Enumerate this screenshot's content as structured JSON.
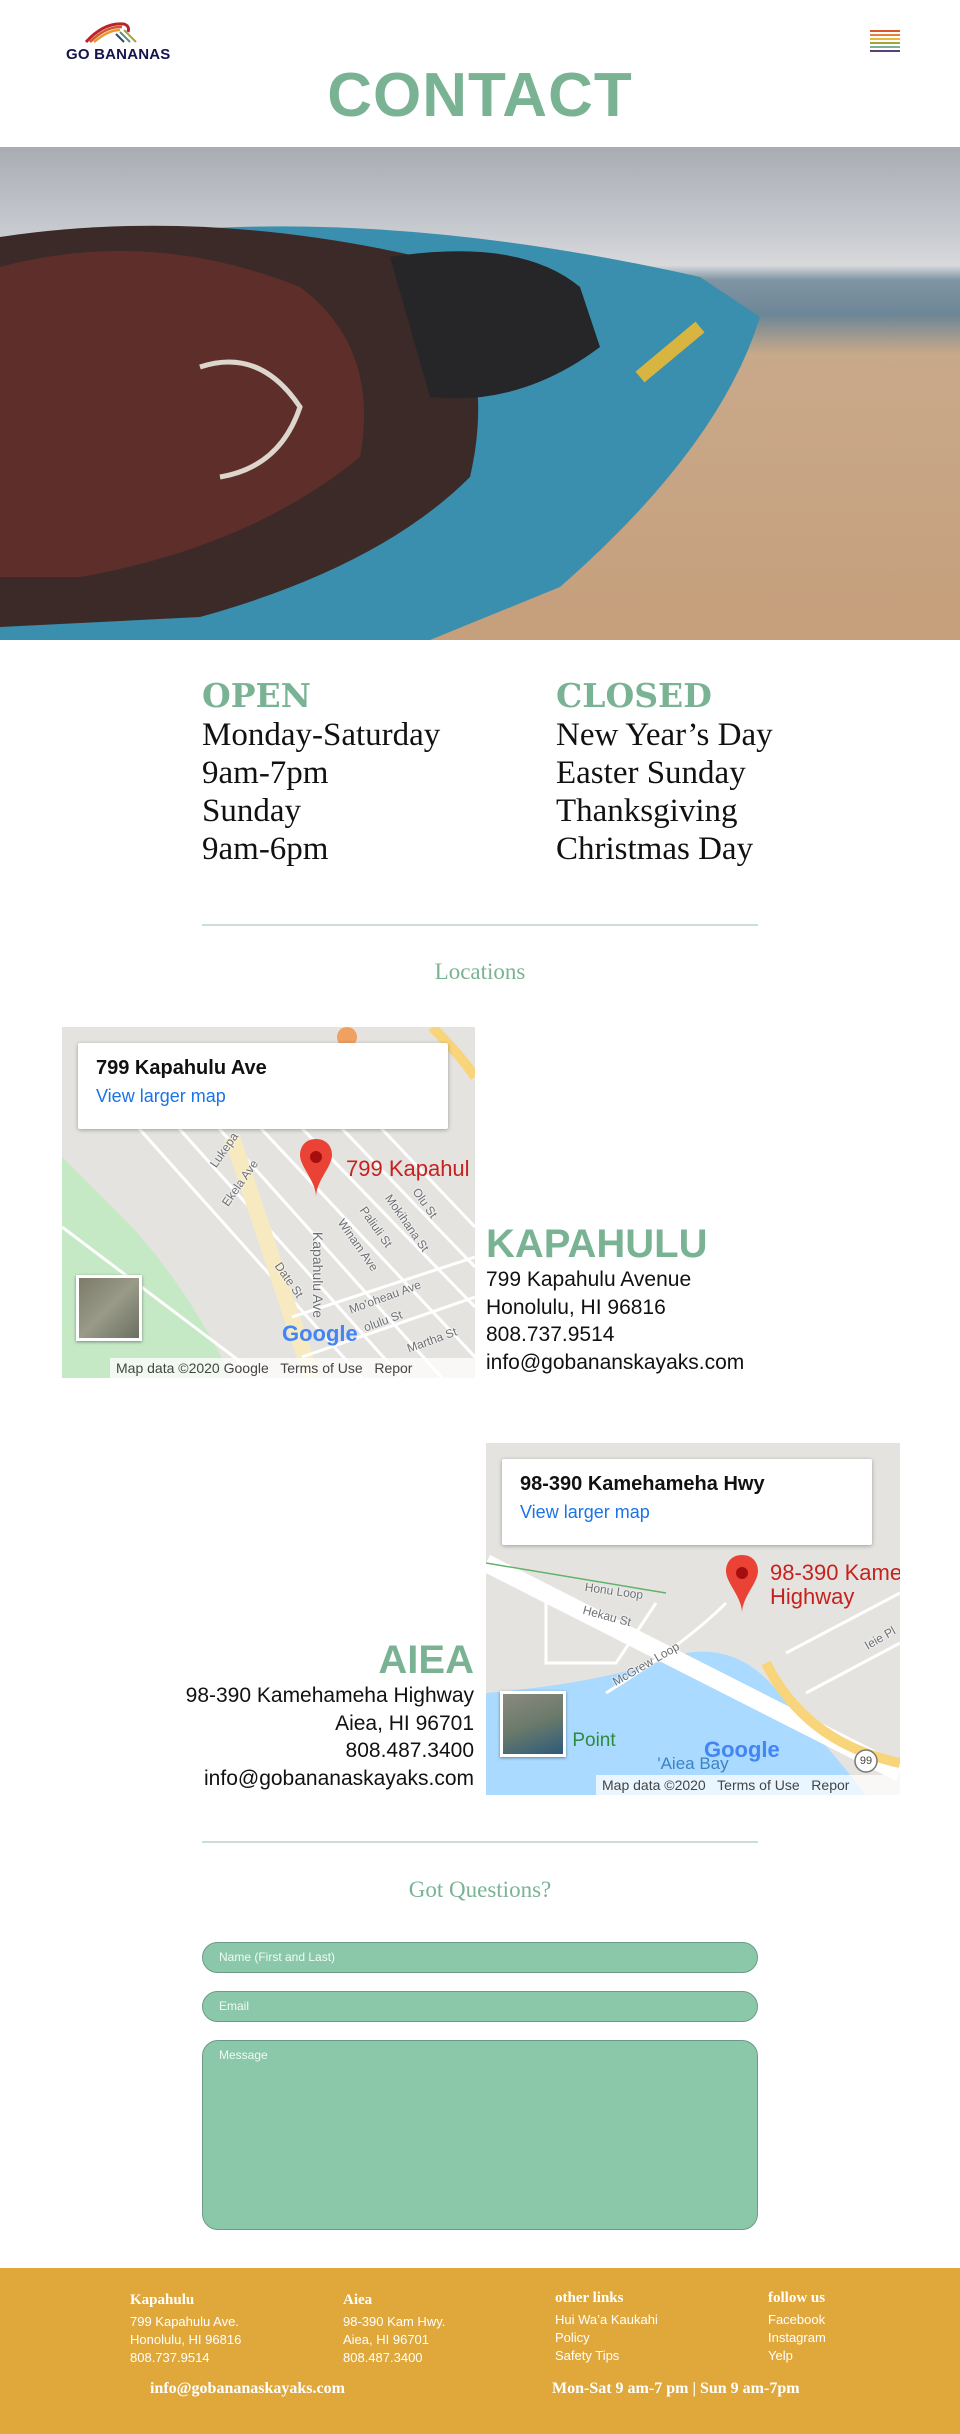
{
  "header": {
    "logo_text": "GO BANANAS",
    "menu_icon": "hamburger-icon",
    "title": "CONTACT"
  },
  "hours": {
    "open": {
      "heading": "OPEN",
      "lines": [
        "Monday-Saturday",
        "9am-7pm",
        "Sunday",
        "9am-6pm"
      ]
    },
    "closed": {
      "heading": "CLOSED",
      "lines": [
        "New Year’s Day",
        "Easter Sunday",
        "Thanksgiving",
        "Christmas Day"
      ]
    }
  },
  "locations_title": "Locations",
  "locations": [
    {
      "name": "KAPAHULU",
      "lines": [
        "799 Kapahulu Avenue",
        "Honolulu, HI 96816",
        "808.737.9514",
        "info@gobananskayaks.com"
      ],
      "map": {
        "card_title": "799 Kapahulu Ave",
        "card_link": "View larger map",
        "pin_label": "799 Kapahul",
        "attribution": "Map data ©2020 Google",
        "terms": "Terms of Use",
        "report": "Repor",
        "streets": [
          "Lukepa",
          "Ekela Ave",
          "Kapahulu Ave",
          "Winam Ave",
          "Paliuli St",
          "Mokihana St",
          "Olu St",
          "Date St",
          "Mo'oheau Ave",
          "olulu St",
          "Martha St"
        ]
      }
    },
    {
      "name": "AIEA",
      "lines": [
        "98-390 Kamehameha Highway",
        "Aiea, HI 96701",
        "808.487.3400",
        "info@gobananaskayaks.com"
      ],
      "map": {
        "card_title": "98-390 Kamehameha Hwy",
        "card_link": "View larger map",
        "pin_label": "98-390 Kame",
        "pin_label2": "Highway",
        "attribution": "Map data ©2020",
        "terms": "Terms of Use",
        "report": "Repor",
        "streets": [
          "Honu Loop",
          "Hekau St",
          "McGrew Loop",
          "Ieie Pl",
          "'Aiea Bay",
          "Point",
          "99"
        ]
      }
    }
  ],
  "form": {
    "title": "Got Questions?",
    "name_placeholder": "Name (First and Last)",
    "email_placeholder": "Email",
    "message_placeholder": "Message"
  },
  "footer": {
    "kapahulu": {
      "heading": "Kapahulu",
      "lines": [
        "799 Kapahulu Ave.",
        "Honolulu, HI 96816",
        "808.737.9514"
      ]
    },
    "aiea": {
      "heading": "Aiea",
      "lines": [
        "98-390 Kam Hwy.",
        "Aiea, HI 96701",
        "808.487.3400"
      ]
    },
    "other_links": {
      "heading": "other links",
      "links": [
        "Hui Wa’a Kaukahi",
        "Policy",
        "Safety Tips"
      ]
    },
    "follow_us": {
      "heading": "follow us",
      "links": [
        "Facebook",
        "Instagram",
        "Yelp"
      ]
    },
    "email": "info@gobananaskayaks.com",
    "hours": "Mon-Sat 9 am-7 pm | Sun 9 am-7pm"
  },
  "colors": {
    "accent": "#7ab394",
    "footer": "#e0a83a",
    "field": "#8bc8aa"
  }
}
